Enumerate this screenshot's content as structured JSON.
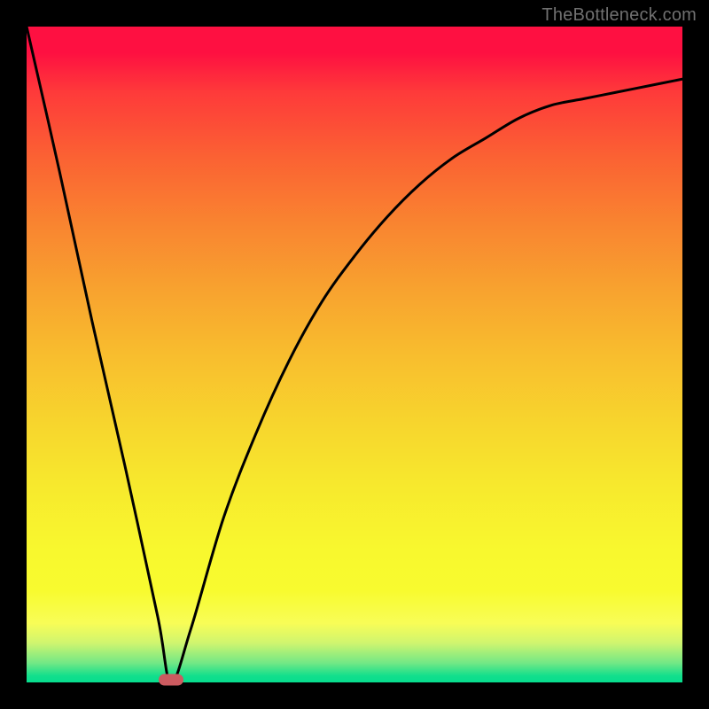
{
  "attribution": "TheBottleneck.com",
  "colors": {
    "background": "#000000",
    "curve": "#000000",
    "marker": "#cc5b60",
    "gradient_top": "#fe1041",
    "gradient_bottom": "#07dd8e"
  },
  "chart_data": {
    "type": "line",
    "title": "",
    "xlabel": "",
    "ylabel": "",
    "xlim": [
      0,
      1
    ],
    "ylim": [
      0,
      1
    ],
    "grid": false,
    "legend": false,
    "description": "V-shaped bottleneck curve on a vertical rainbow gradient (red at top through orange, yellow, to green at bottom). The curve plunges nearly linearly from top-left to a minimum near x≈0.22 at the bottom edge, then rises as a concave curve approaching the top-right. A small rounded red marker sits at the minimum. Values are estimated from pixels (no axes or labels present).",
    "series": [
      {
        "name": "curve",
        "x": [
          0.0,
          0.05,
          0.1,
          0.15,
          0.2,
          0.22,
          0.25,
          0.3,
          0.35,
          0.4,
          0.45,
          0.5,
          0.55,
          0.6,
          0.65,
          0.7,
          0.75,
          0.8,
          0.85,
          0.9,
          0.95,
          1.0
        ],
        "y": [
          1.0,
          0.78,
          0.55,
          0.33,
          0.1,
          0.0,
          0.08,
          0.25,
          0.38,
          0.49,
          0.58,
          0.65,
          0.71,
          0.76,
          0.8,
          0.83,
          0.86,
          0.88,
          0.89,
          0.9,
          0.91,
          0.92
        ]
      }
    ],
    "marker": {
      "x": 0.22,
      "y": 0.0
    }
  }
}
